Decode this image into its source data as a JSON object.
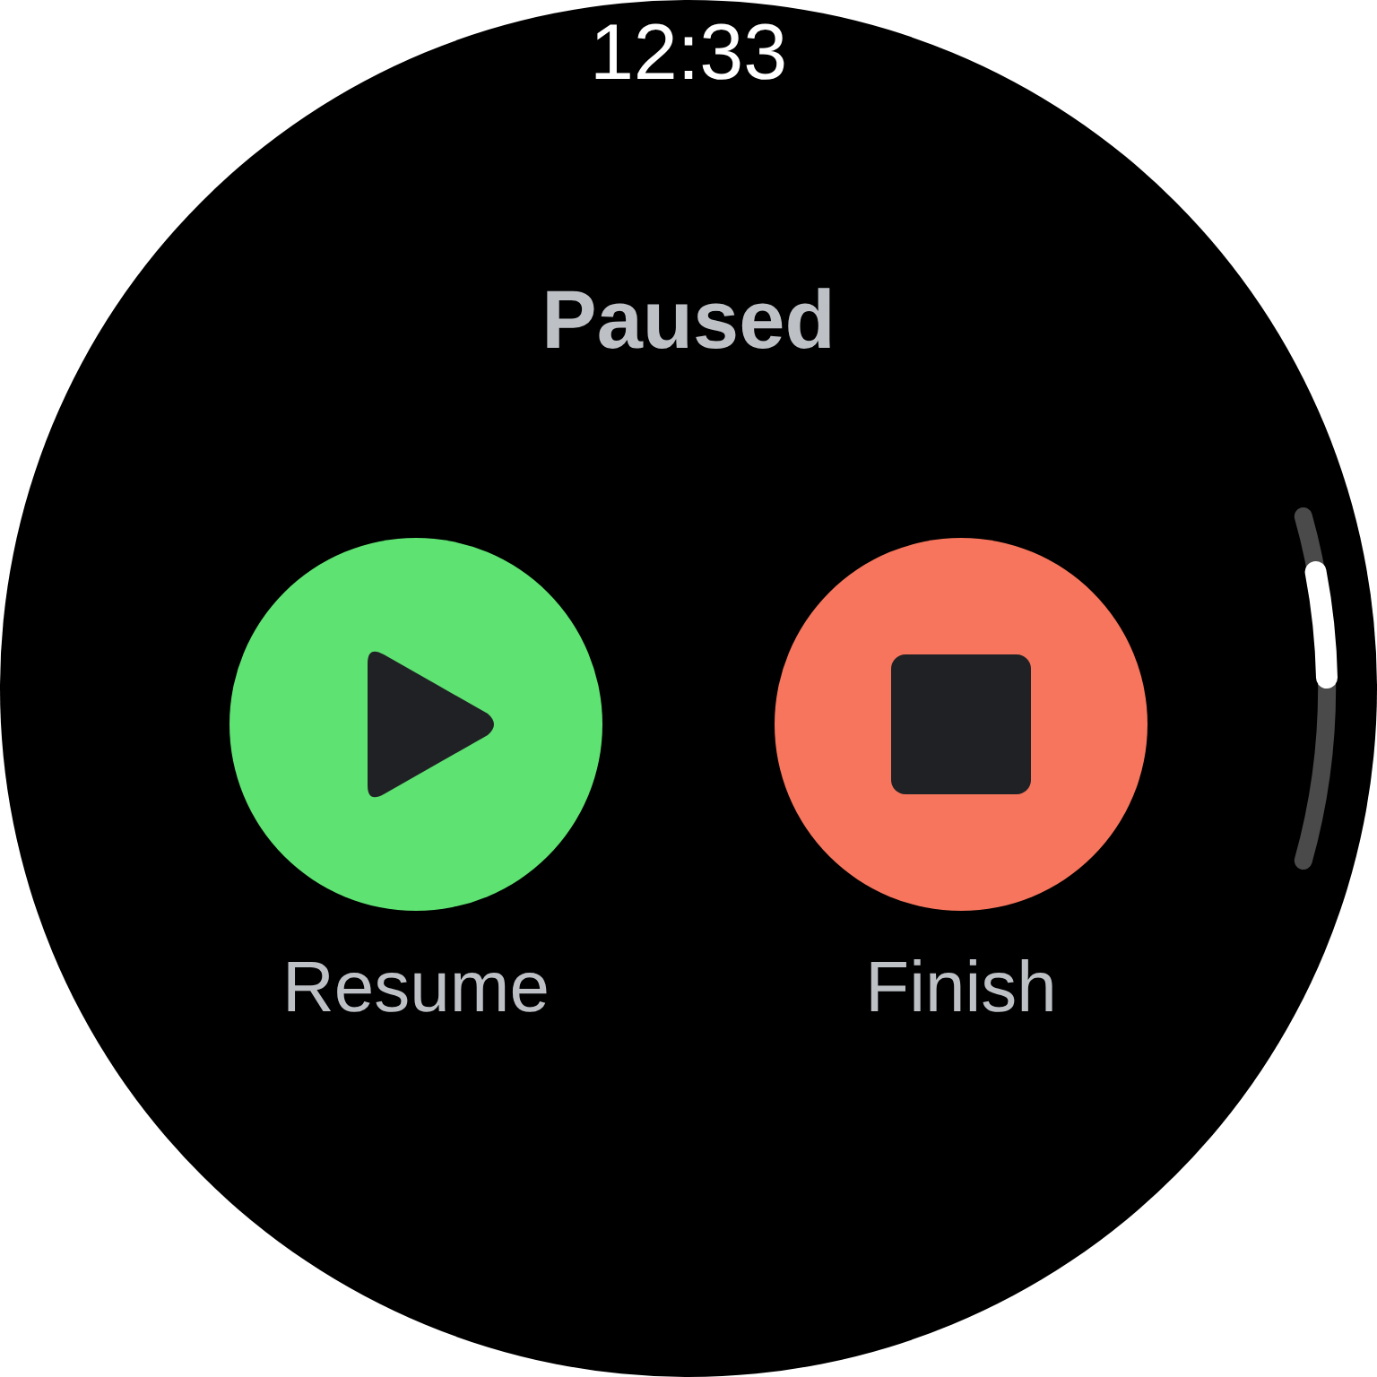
{
  "status_bar": {
    "time": "12:33"
  },
  "title": "Paused",
  "actions": [
    {
      "kind": "resume",
      "label": "Resume"
    },
    {
      "kind": "finish",
      "label": "Finish"
    }
  ]
}
